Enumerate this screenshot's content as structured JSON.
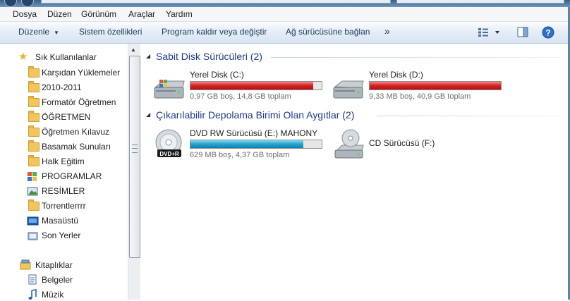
{
  "menu": [
    "Dosya",
    "Düzen",
    "Görünüm",
    "Araçlar",
    "Yardım"
  ],
  "toolbar": {
    "organize": "Düzenle",
    "system_props": "Sistem özellikleri",
    "uninstall": "Program kaldır veya değiştir",
    "map_drive": "Ağ sürücüsüne bağlan",
    "more": "»"
  },
  "nav": {
    "favorites_header": "Sık Kullanılanlar",
    "favorites": [
      "Karşıdan Yüklemeler",
      "2010-2011",
      "Formatör Öğretmen",
      "ÖĞRETMEN",
      "Öğretmen Kılavuz",
      "Basamak Sunuları",
      "Halk Eğitim",
      "PROGRAMLAR",
      "RESİMLER",
      "Torrentlerrrr",
      "Masaüstü",
      "Son Yerler"
    ],
    "libraries_header": "Kitaplıklar",
    "libraries": [
      "Belgeler",
      "Müzik"
    ]
  },
  "groups": {
    "hdd_title": "Sabit Disk Sürücüleri (2)",
    "removable_title": "Çıkarılabilir Depolama Birimi Olan Aygıtlar (2)"
  },
  "drives": [
    {
      "name": "Yerel Disk (C:)",
      "info": "0,97 GB boş, 14,8 GB toplam",
      "used_fraction": 0.934,
      "color": "#d92626"
    },
    {
      "name": "Yerel Disk (D:)",
      "info": "9,33 MB boş, 40,9 GB toplam",
      "used_fraction": 1.0,
      "color": "#d92626"
    },
    {
      "name": "DVD RW Sürücüsü (E:) MAHONY",
      "info": "629 MB boş, 4,37 GB toplam",
      "used_fraction": 0.859,
      "color": "#27a6d4"
    },
    {
      "name": "CD Sürücüsü (F:)"
    }
  ],
  "dvd_badge": "DVD+R"
}
